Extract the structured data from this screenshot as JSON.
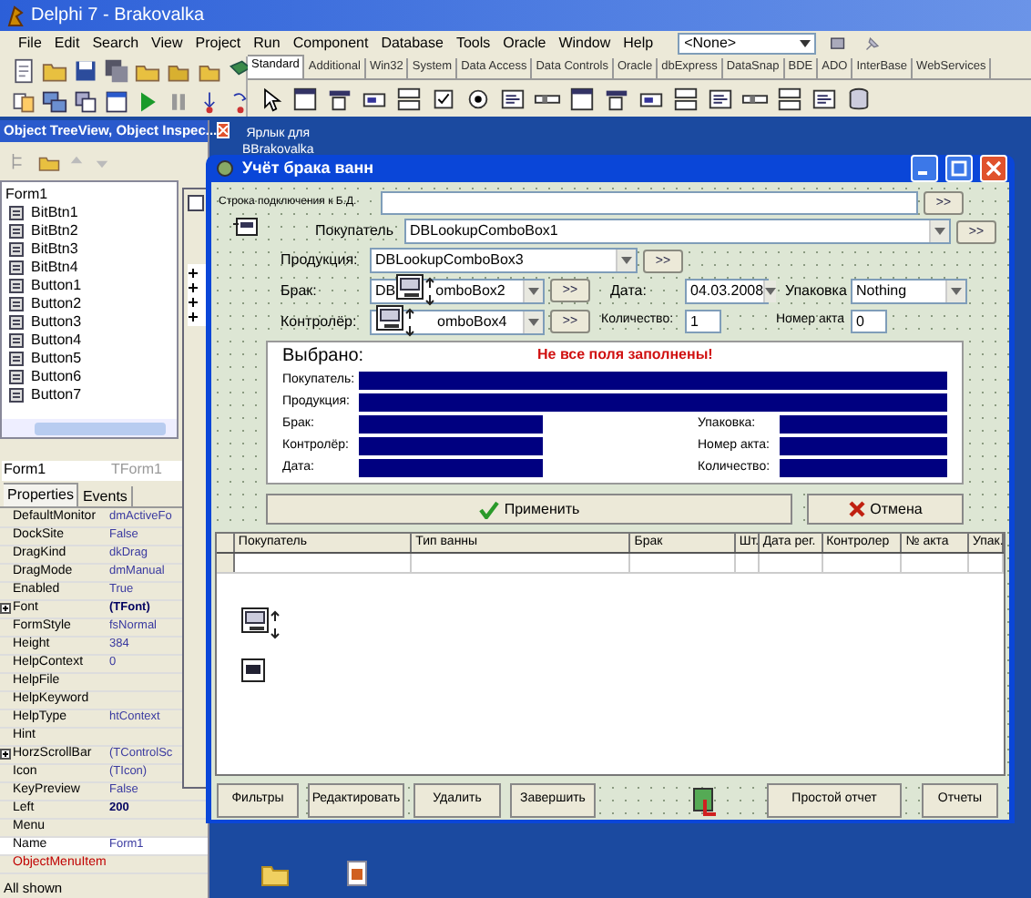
{
  "ide": {
    "title": "Delphi 7 - Brakovalka",
    "menu": [
      "File",
      "Edit",
      "Search",
      "View",
      "Project",
      "Run",
      "Component",
      "Database",
      "Tools",
      "Oracle",
      "Window",
      "Help"
    ],
    "config_dropdown": "<None>",
    "palette_tabs": [
      {
        "label": "Standard",
        "selected": true
      },
      {
        "label": "Additional",
        "selected": false
      },
      {
        "label": "Win32",
        "selected": false
      },
      {
        "label": "System",
        "selected": false
      },
      {
        "label": "Data Access",
        "selected": false
      },
      {
        "label": "Data Controls",
        "selected": false
      },
      {
        "label": "Oracle",
        "selected": false
      },
      {
        "label": "dbExpress",
        "selected": false
      },
      {
        "label": "DataSnap",
        "selected": false
      },
      {
        "label": "BDE",
        "selected": false
      },
      {
        "label": "ADO",
        "selected": false
      },
      {
        "label": "InterBase",
        "selected": false
      },
      {
        "label": "WebServices",
        "selected": false
      }
    ]
  },
  "desktop_shortcut": {
    "lines": [
      "Ярлык для",
      "BBrakovalka"
    ]
  },
  "object_inspector": {
    "title": "Object TreeView, Object Inspec...",
    "tree": [
      {
        "label": "Form1",
        "children": [
          {
            "label": "BitBtn1"
          },
          {
            "label": "BitBtn2"
          },
          {
            "label": "BitBtn3"
          },
          {
            "label": "BitBtn4"
          },
          {
            "label": "Button1"
          },
          {
            "label": "Button2"
          },
          {
            "label": "Button3"
          },
          {
            "label": "Button4"
          },
          {
            "label": "Button5"
          },
          {
            "label": "Button6"
          },
          {
            "label": "Button7"
          }
        ]
      }
    ],
    "object_name": "Form1",
    "object_type": "TForm1",
    "tabs": [
      {
        "label": "Properties",
        "selected": true
      },
      {
        "label": "Events",
        "selected": false
      }
    ],
    "properties": [
      {
        "name": "DefaultMonitor",
        "value": "dmActiveFo",
        "kind": "plain",
        "modified": false,
        "selected": false
      },
      {
        "name": "DockSite",
        "value": "False",
        "kind": "plain",
        "modified": false,
        "selected": false
      },
      {
        "name": "DragKind",
        "value": "dkDrag",
        "kind": "plain",
        "modified": false,
        "selected": false
      },
      {
        "name": "DragMode",
        "value": "dmManual",
        "kind": "plain",
        "modified": false,
        "selected": false
      },
      {
        "name": "Enabled",
        "value": "True",
        "kind": "plain",
        "modified": false,
        "selected": false
      },
      {
        "name": "Font",
        "value": "(TFont)",
        "kind": "expandable",
        "modified": true,
        "selected": false
      },
      {
        "name": "FormStyle",
        "value": "fsNormal",
        "kind": "plain",
        "modified": false,
        "selected": false
      },
      {
        "name": "Height",
        "value": "384",
        "kind": "plain",
        "modified": false,
        "selected": false
      },
      {
        "name": "HelpContext",
        "value": "0",
        "kind": "plain",
        "modified": false,
        "selected": false
      },
      {
        "name": "HelpFile",
        "kind": "plain",
        "selected": false
      },
      {
        "name": "HelpKeyword",
        "kind": "plain",
        "selected": false
      },
      {
        "name": "HelpType",
        "value": "htContext",
        "kind": "plain",
        "modified": false,
        "selected": false
      },
      {
        "name": "Hint",
        "kind": "plain",
        "selected": false
      },
      {
        "name": "HorzScrollBar",
        "value": "(TControlSc",
        "kind": "expandable",
        "modified": false,
        "selected": false
      },
      {
        "name": "Icon",
        "value": "(TIcon)",
        "kind": "plain",
        "modified": false,
        "selected": false
      },
      {
        "name": "KeyPreview",
        "value": "False",
        "kind": "plain",
        "modified": false,
        "selected": false
      },
      {
        "name": "Left",
        "value": "200",
        "kind": "plain",
        "modified": true,
        "selected": false
      },
      {
        "name": "Menu",
        "kind": "plain",
        "selected": false
      },
      {
        "name": "Name",
        "value": "Form1",
        "kind": "plain",
        "modified": false,
        "selected": true
      },
      {
        "name": "ObjectMenuItem",
        "kind": "reference",
        "selected": false
      }
    ],
    "status": "All shown"
  },
  "form": {
    "title": "Учёт брака ванн",
    "connection": {
      "label": "Строка подключения к Б.Д.",
      "button": ">>"
    },
    "buyer": {
      "label": "Покупатель",
      "value": "DBLookupComboBox1",
      "button": ">>"
    },
    "product": {
      "label": "Продукция:",
      "value": "DBLookupComboBox3",
      "button": ">>"
    },
    "defect": {
      "label": "Брак:",
      "value_start": "DB",
      "value_end": "omboBox2",
      "button": ">>"
    },
    "date": {
      "label": "Дата:",
      "value": "04.03.2008"
    },
    "packing": {
      "label": "Упаковка",
      "value": "Nothing"
    },
    "inspector": {
      "label": "Контролёр:",
      "value": "omboBox4",
      "button": ">>"
    },
    "quantity": {
      "label": "Количество:",
      "value": "1"
    },
    "act_number": {
      "label": "Номер акта",
      "value": "0"
    },
    "summary": {
      "heading": "Выбрано:",
      "warning": "Не все поля заполнены!",
      "wide_rows": [
        "Покупатель:",
        "Продукция:"
      ],
      "left_rows": [
        "Брак:",
        "Контролёр:",
        "Дата:"
      ],
      "right_rows": [
        "Упаковка:",
        "Номер акта:",
        "Количество:"
      ]
    },
    "apply_button": "Применить",
    "cancel_button": "Отмена",
    "table": {
      "columns": [
        "Покупатель",
        "Тип ванны",
        "Брак",
        "Шт.",
        "Дата рег.",
        "Контролер",
        "№ акта",
        "Упак."
      ]
    },
    "bottom_buttons": [
      "Фильтры",
      "Редактировать",
      "Удалить",
      "Завершить"
    ],
    "report_buttons": [
      "Простой отчет",
      "Отчеты"
    ]
  }
}
